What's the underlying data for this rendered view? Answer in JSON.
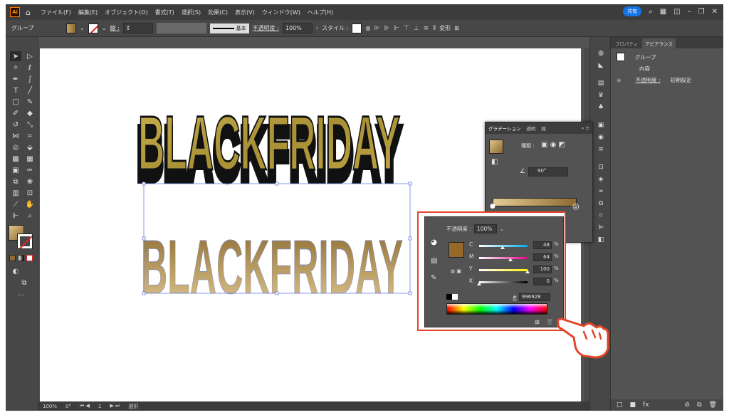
{
  "app": {
    "logo": "Ai"
  },
  "menu": {
    "items": [
      "ファイル(F)",
      "編集(E)",
      "オブジェクト(O)",
      "書式(T)",
      "選択(S)",
      "効果(C)",
      "表示(V)",
      "ウィンドウ(W)",
      "ヘルプ(H)"
    ],
    "share_label": "共有"
  },
  "controlbar": {
    "selection_label": "グループ",
    "stroke_label": "線 :",
    "stroke_style_label": "基本",
    "opacity_label": "不透明度 :",
    "opacity_value": "100%",
    "style_label": "スタイル :",
    "transform_label": "変形"
  },
  "artwork": {
    "text_top": "BLACKFRIDAY",
    "text_bottom": "BLACKFRIDAY",
    "gold_color": "#b8a040",
    "gradient_start": "#e0c890",
    "gradient_end": "#8a6a30"
  },
  "gradient_panel": {
    "tabs": [
      "グラデーション",
      "透明",
      "線"
    ],
    "type_label": "種類 :",
    "angle_value": "90°"
  },
  "color_panel": {
    "opacity_label": "不透明度 :",
    "opacity_value": "100%",
    "channels": [
      {
        "name": "C",
        "value": "48",
        "unit": "%",
        "percent": 48,
        "color_start": "#ffffff",
        "color_end": "#00aeef"
      },
      {
        "name": "M",
        "value": "64",
        "unit": "%",
        "percent": 64,
        "color_start": "#ffffff",
        "color_end": "#ec008c"
      },
      {
        "name": "Y",
        "value": "100",
        "unit": "%",
        "percent": 100,
        "color_start": "#ffffff",
        "color_end": "#fff200"
      },
      {
        "name": "K",
        "value": "0",
        "unit": "%",
        "percent": 0,
        "color_start": "#ffffff",
        "color_end": "#000000"
      }
    ],
    "hex_symbol": "#",
    "hex_value": "996928",
    "current_color": "#96692a"
  },
  "right_panel": {
    "tabs": [
      "プロパティ",
      "アピアランス"
    ],
    "title": "グループ",
    "content_label": "内容",
    "opacity_label": "不透明度 :",
    "opacity_value": "初期設定"
  },
  "status": {
    "zoom": "100%",
    "rotation": "0°",
    "artboard_num": "1",
    "mode": "選択"
  },
  "accent_color": "#e4452a"
}
